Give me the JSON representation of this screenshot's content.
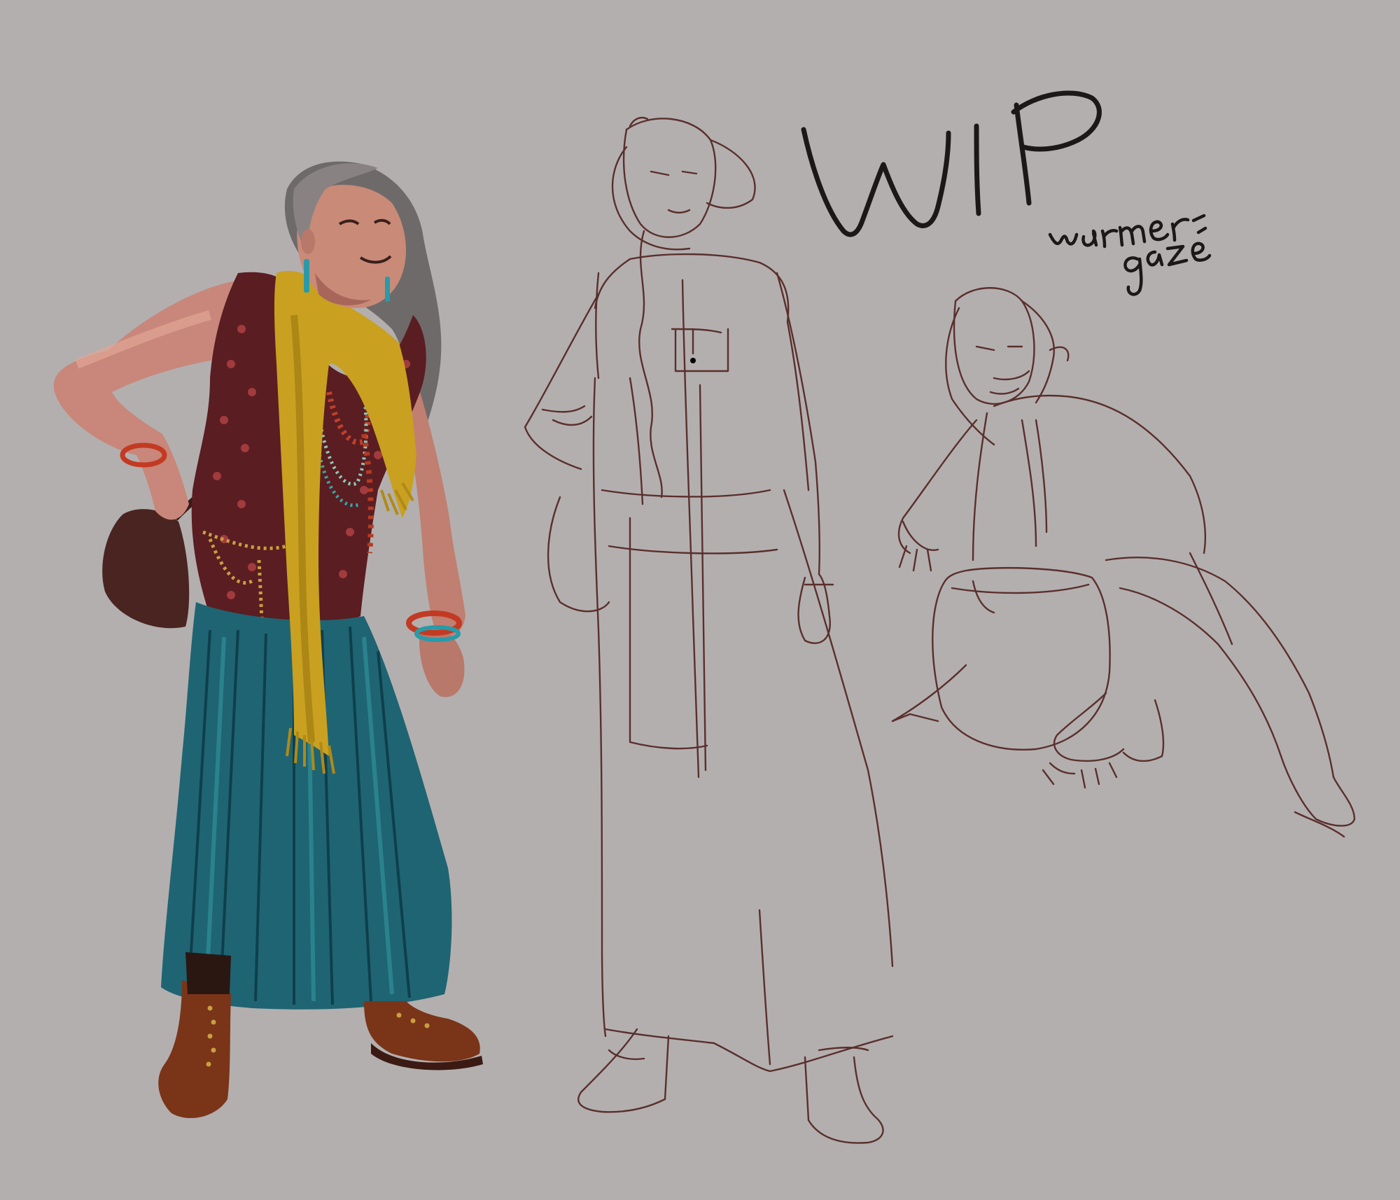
{
  "annotations": {
    "title": "WIP",
    "note_line1": "warmer-",
    "note_line2": "gaze"
  },
  "colors": {
    "background": "#b3afaf",
    "sketch_line": "#5a2f2c",
    "handwriting": "#1c1818",
    "scarf": "#c9a020",
    "skirt": "#1f6472",
    "vest": "#5a1d22",
    "boots": "#7a3418",
    "skin": "#c98a78",
    "hair": "#6e6a6a"
  },
  "figures": [
    {
      "name": "painted-character",
      "description_icon": "painted-woman-figure"
    },
    {
      "name": "standing-sketch",
      "description_icon": "standing-sketch-figure"
    },
    {
      "name": "crouching-sketch",
      "description_icon": "crouching-sketch-figure"
    }
  ]
}
